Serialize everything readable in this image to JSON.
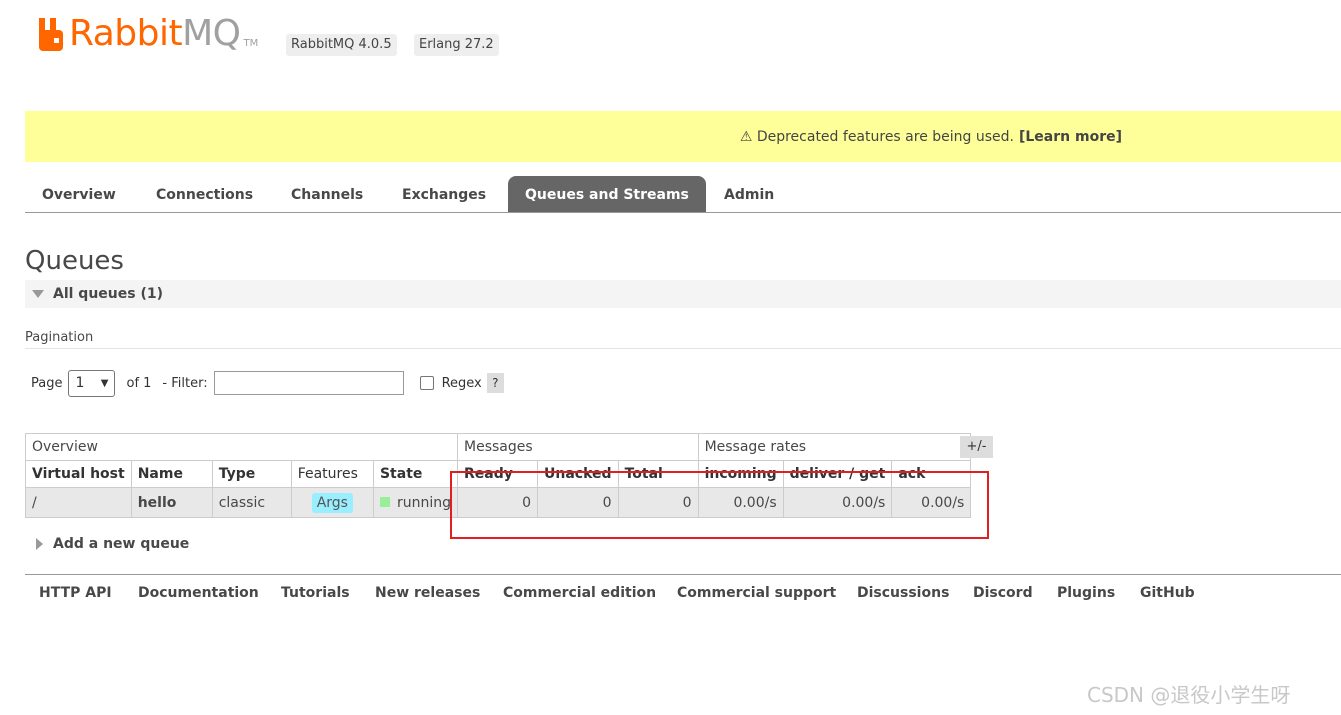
{
  "header": {
    "logo_rabbit": "Rabbit",
    "logo_mq": "MQ",
    "logo_tm": "TM",
    "rabbitmq_version": "RabbitMQ 4.0.5",
    "erlang_version": "Erlang 27.2"
  },
  "banner": {
    "text": "⚠ Deprecated features are being used.",
    "link": "[Learn more]"
  },
  "tabs": [
    {
      "label": "Overview"
    },
    {
      "label": "Connections"
    },
    {
      "label": "Channels"
    },
    {
      "label": "Exchanges"
    },
    {
      "label": "Queues and Streams",
      "active": true
    },
    {
      "label": "Admin"
    }
  ],
  "page": {
    "title": "Queues",
    "section_label": "All queues (1)"
  },
  "pagination": {
    "label": "Pagination",
    "page_label": "Page",
    "page_value": "1",
    "of_label": "of 1",
    "filter_label": "- Filter:",
    "filter_value": "",
    "regex_label": "Regex",
    "help": "?"
  },
  "table": {
    "groups": [
      "Overview",
      "Messages",
      "Message rates"
    ],
    "columns": [
      "Virtual host",
      "Name",
      "Type",
      "Features",
      "State",
      "Ready",
      "Unacked",
      "Total",
      "incoming",
      "deliver / get",
      "ack"
    ],
    "row": {
      "vhost": "/",
      "name": "hello",
      "type": "classic",
      "features": "Args",
      "state": "running",
      "ready": "0",
      "unacked": "0",
      "total": "0",
      "incoming": "0.00/s",
      "deliver_get": "0.00/s",
      "ack": "0.00/s"
    },
    "toggle": "+/-"
  },
  "add_queue": "Add a new queue",
  "footer": [
    "HTTP API",
    "Documentation",
    "Tutorials",
    "New releases",
    "Commercial edition",
    "Commercial support",
    "Discussions",
    "Discord",
    "Plugins",
    "GitHub"
  ],
  "watermark": "CSDN @退役小学生呀",
  "colors": {
    "brand_orange": "#ff6600",
    "banner_yellow": "#ffff99",
    "active_tab": "#666666",
    "args_badge": "#99eeff",
    "running": "#99ee99",
    "highlight_red": "#e02020"
  }
}
